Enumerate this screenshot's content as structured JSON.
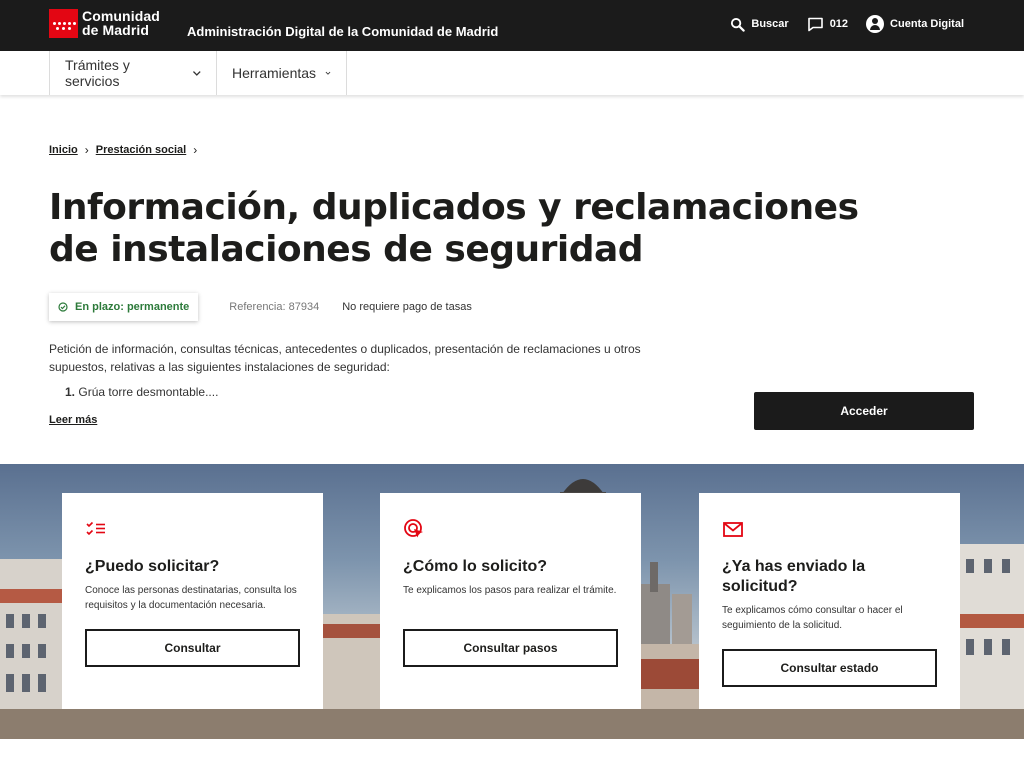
{
  "header": {
    "logo_line1": "Comunidad",
    "logo_line2": "de Madrid",
    "site_title": "Administración Digital de la Comunidad de Madrid",
    "search_label": "Buscar",
    "phone_label": "012",
    "account_label": "Cuenta Digital"
  },
  "nav": {
    "items": [
      {
        "label": "Trámites y servicios",
        "icon": "chevron-down-icon"
      },
      {
        "label": "Herramientas",
        "icon": "chevron-down-icon"
      }
    ]
  },
  "breadcrumb": {
    "items": [
      "Inicio",
      "Prestación social"
    ]
  },
  "page": {
    "title": "Información, duplicados y reclamaciones de instalaciones de seguridad",
    "status_badge": "En plazo: permanente",
    "reference": "Referencia: 87934",
    "fees": "No requiere pago de tasas",
    "description": "Petición de información, consultas técnicas, antecedentes o duplicados, presentación de reclamaciones u otros supuestos, relativas a las siguientes instalaciones de seguridad:",
    "list_number": "1.",
    "list_item": "Grúa torre desmontable....",
    "read_more": "Leer más",
    "access_button": "Acceder"
  },
  "cards": [
    {
      "icon": "checklist-icon",
      "title": "¿Puedo solicitar?",
      "text": "Conoce las personas destinatarias, consulta los requisitos y la documentación necesaria.",
      "button": "Consultar"
    },
    {
      "icon": "click-target-icon",
      "title": "¿Cómo lo solicito?",
      "text": "Te explicamos los pasos para realizar el trámite.",
      "button": "Consultar pasos"
    },
    {
      "icon": "envelope-icon",
      "title": "¿Ya has enviado la solicitud?",
      "text": "Te explicamos cómo consultar o hacer el seguimiento de la solicitud.",
      "button": "Consultar estado"
    }
  ],
  "colors": {
    "brand_red": "#e30613",
    "dark": "#1b1b1b",
    "status_green": "#2c7a3a"
  }
}
